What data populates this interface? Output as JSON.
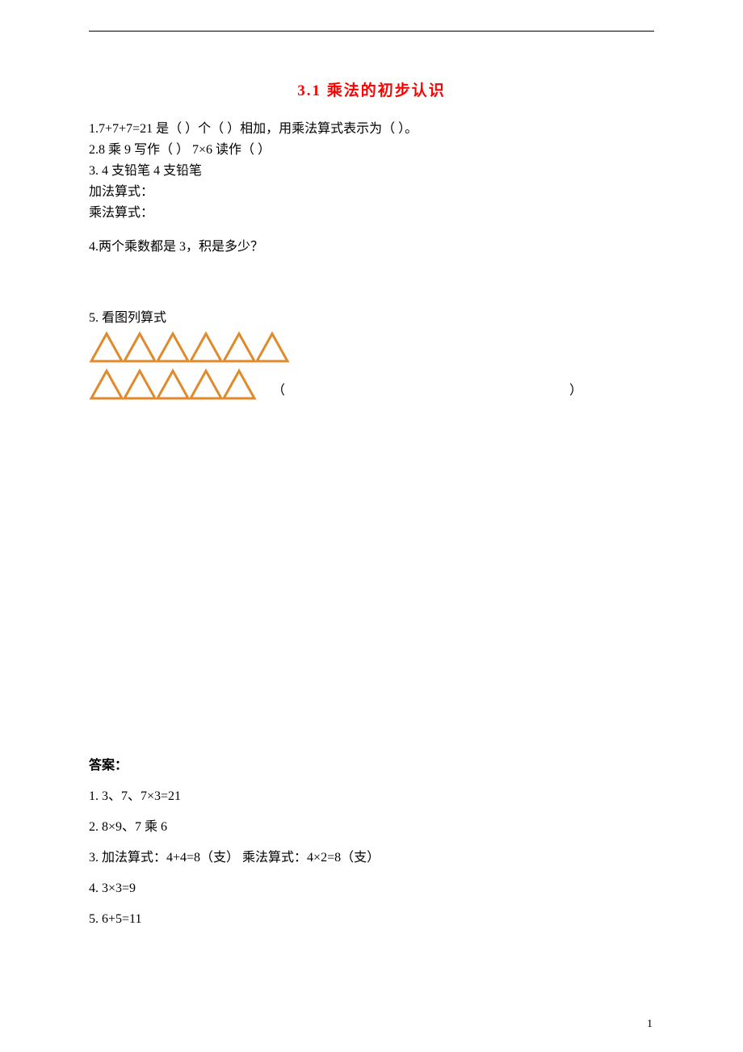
{
  "title": "3.1 乘法的初步认识",
  "questions": {
    "q1": "1.7+7+7=21 是（   ）个（  ）相加，用乘法算式表示为（      ）。",
    "q2": "2.8 乘 9 写作（           ）    7×6 读作（      ）",
    "q3a": "3.   4 支铅笔         4 支铅笔",
    "q3b": "加法算式：",
    "q3c": "乘法算式：",
    "q4": "4.两个乘数都是 3，积是多少？",
    "q5header": "5.   看图列算式",
    "q5parenL": "（",
    "q5parenR": "）"
  },
  "answers": {
    "heading": "答案：",
    "a1": "1.  3、7、7×3=21",
    "a2": "2.  8×9、7 乘 6",
    "a3": "3.  加法算式：4+4=8（支）      乘法算式：4×2=8（支）",
    "a4": "4.  3×3=9",
    "a5": "5.  6+5=11"
  },
  "pageNumber": "1",
  "triangleRows": {
    "row1": 6,
    "row2": 5
  }
}
